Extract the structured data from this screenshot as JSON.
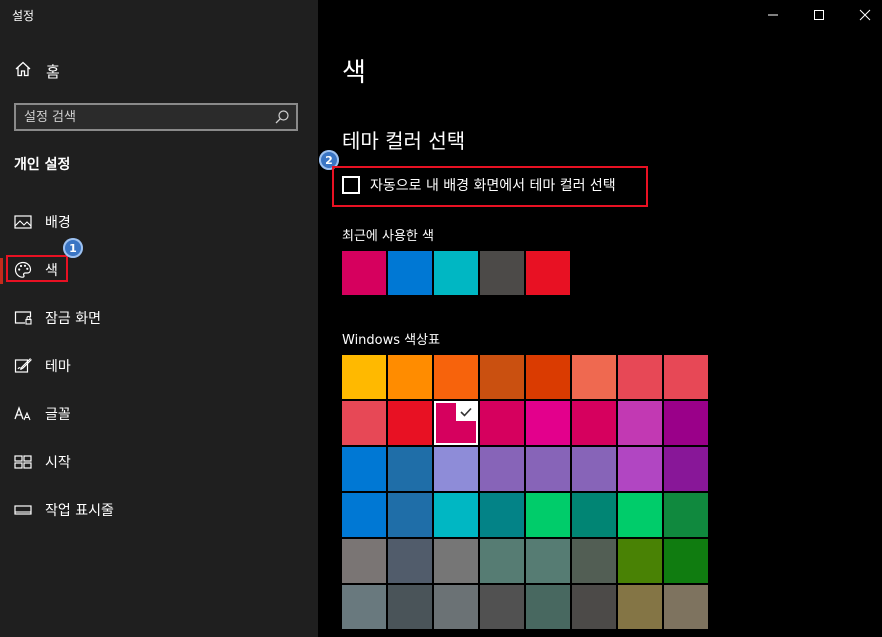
{
  "window": {
    "title": "설정"
  },
  "sidebar": {
    "home_label": "홈",
    "search_placeholder": "설정 검색",
    "section_title": "개인 설정",
    "items": [
      {
        "label": "배경",
        "icon": "picture-icon"
      },
      {
        "label": "색",
        "icon": "palette-icon",
        "selected": true
      },
      {
        "label": "잠금 화면",
        "icon": "lock-screen-icon"
      },
      {
        "label": "테마",
        "icon": "theme-brush-icon"
      },
      {
        "label": "글꼴",
        "icon": "font-icon"
      },
      {
        "label": "시작",
        "icon": "start-tiles-icon"
      },
      {
        "label": "작업 표시줄",
        "icon": "taskbar-icon"
      }
    ]
  },
  "annotations": {
    "badge1": "1",
    "badge2": "2",
    "highlight_color": "#e81123"
  },
  "main": {
    "title": "색",
    "section_title": "테마 컬러 선택",
    "auto_checkbox_label": "자동으로 내 배경 화면에서 테마 컬러 선택",
    "auto_checkbox_checked": false,
    "recent_label": "최근에 사용한 색",
    "recent_colors": [
      "#d6005e",
      "#0078d4",
      "#00b7c3",
      "#4c4a48",
      "#e81123"
    ],
    "palette_label": "Windows 색상표",
    "palette": [
      [
        "#ffb900",
        "#ff8c00",
        "#f7630c",
        "#ca5010",
        "#da3b01",
        "#ef6950",
        "#e74856",
        "#e74856"
      ],
      [
        "#e74856",
        "#e81123",
        "#d6005e",
        "#d6005e",
        "#e3008c",
        "#d6005e",
        "#c239b3",
        "#9a0089"
      ],
      [
        "#0078d4",
        "#1f6ea8",
        "#8e8cd8",
        "#8764b8",
        "#8764b8",
        "#8764b8",
        "#b146c2",
        "#881798"
      ],
      [
        "#0078d4",
        "#1f6ea8",
        "#00b7c3",
        "#038387",
        "#00cc6a",
        "#018574",
        "#00cc6a",
        "#10893e"
      ],
      [
        "#7a7574",
        "#515c6b",
        "#767676",
        "#567c73",
        "#567c73",
        "#525e54",
        "#498205",
        "#107c10"
      ],
      [
        "#69797e",
        "#4a5459",
        "#6b7275",
        "#515151",
        "#486860",
        "#4c4a48",
        "#847545",
        "#7e735f"
      ]
    ],
    "selected_palette": [
      1,
      2
    ]
  }
}
